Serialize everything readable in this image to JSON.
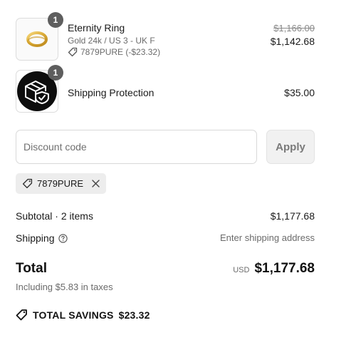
{
  "items": [
    {
      "quantity": "1",
      "name": "Eternity Ring",
      "variant": "Gold 24k / US 3 - UK F",
      "discount": "7879PURE (-$23.32)",
      "original_price": "$1,166.00",
      "price": "$1,142.68",
      "image": "gold-ring-image"
    },
    {
      "quantity": "1",
      "name": "Shipping Protection",
      "price": "$35.00",
      "image": "package-shield-icon"
    }
  ],
  "discount": {
    "placeholder": "Discount code",
    "apply_label": "Apply",
    "applied_code": "7879PURE"
  },
  "summary": {
    "subtotal_label": "Subtotal · 2 items",
    "subtotal_value": "$1,177.68",
    "shipping_label": "Shipping",
    "shipping_value": "Enter shipping address",
    "total_label": "Total",
    "total_currency": "USD",
    "total_value": "$1,177.68",
    "taxes_text": "Including $5.83 in taxes",
    "savings_label": "TOTAL SAVINGS",
    "savings_value": "$23.32"
  },
  "colors": {
    "badge": "#5e5e5e",
    "chip_background": "#ededed",
    "button_background": "#f1f1f1"
  }
}
